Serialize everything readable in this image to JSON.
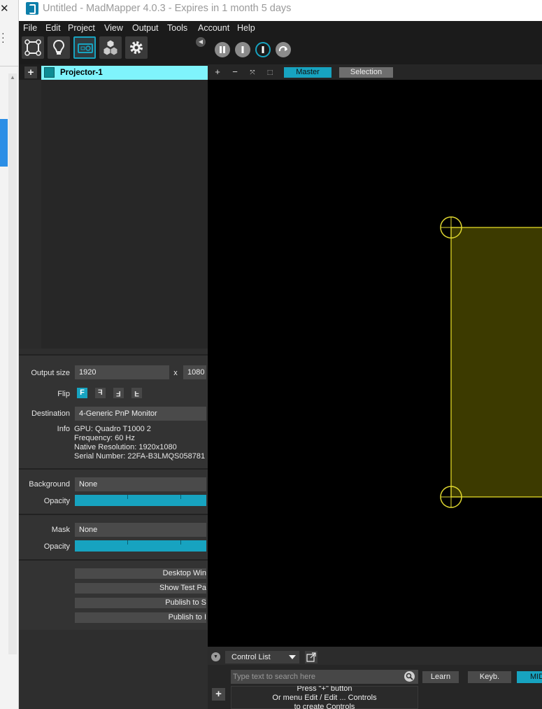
{
  "window": {
    "title": "Untitled - MadMapper 4.0.3 - Expires in 1 month 5 days"
  },
  "menu": [
    "File",
    "Edit",
    "Project",
    "View",
    "Output",
    "Tools",
    "Account",
    "Help"
  ],
  "toolbar": {
    "tools": [
      "surface-tool-icon",
      "lightbulb-icon",
      "projector-icon",
      "cubes-icon",
      "gear-icon"
    ],
    "active_tool": "projector-icon",
    "transport": [
      "pause-icon",
      "stop-icon",
      "play-icon",
      "loop-icon"
    ]
  },
  "projectors": {
    "items": [
      {
        "name": "Projector-1",
        "color": "#0e8c94"
      }
    ]
  },
  "properties": {
    "output_size_label": "Output size",
    "width": "1920",
    "x_sep": "x",
    "height": "1080",
    "flip_label": "Flip",
    "flip_glyphs": [
      "F",
      "F",
      "F",
      "F"
    ],
    "destination_label": "Destination",
    "destination_value": "4-Generic PnP Monitor",
    "info_label": "Info",
    "info_lines": [
      "GPU: Quadro T1000 2",
      "Frequency: 60 Hz",
      "Native Resolution: 1920x1080",
      "Serial Number: 22FA-B3LMQS058781"
    ],
    "background_label": "Background",
    "background_value": "None",
    "opacity_label": "Opacity",
    "background_opacity": 1.0,
    "mask_label": "Mask",
    "mask_value": "None",
    "mask_opacity": 1.0,
    "buttons": [
      "Desktop Win",
      "Show Test Pa",
      "Publish to S",
      "Publish to I"
    ]
  },
  "canvas": {
    "tabs": [
      "Master",
      "Selection"
    ],
    "active_tab": "Master",
    "view_controls": [
      "+",
      "−",
      "fit-icon",
      "frame-icon"
    ]
  },
  "control_panel": {
    "list_selector": "Control List",
    "search_placeholder": "Type text to search here",
    "learn_label": "Learn",
    "keyb_label": "Keyb.",
    "midi_label": "MIDI",
    "hint_lines": [
      "Press \"+\" button",
      "Or menu Edit / Edit ... Controls",
      "to create Controls"
    ]
  },
  "colors": {
    "accent": "#17a3c0",
    "selected_item": "#7ff4fc",
    "surface_fill": "#3c3a00",
    "surface_outline": "#c8c020"
  }
}
